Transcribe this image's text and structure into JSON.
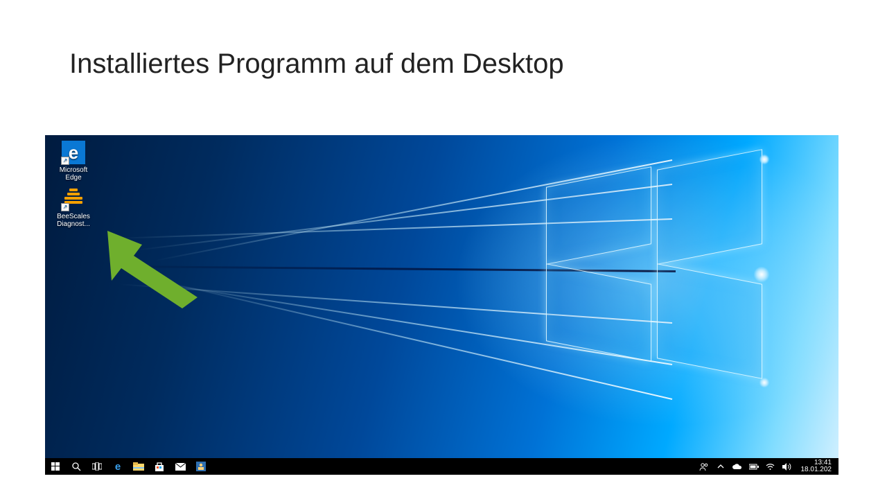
{
  "slide": {
    "title": "Installiertes Programm auf dem Desktop"
  },
  "desktop_icons": [
    {
      "label": "Microsoft Edge"
    },
    {
      "label": "BeeScales Diagnost..."
    }
  ],
  "taskbar": {
    "clock": {
      "time": "13:41",
      "date": "18.01.202"
    },
    "left_icons": [
      "start",
      "search",
      "taskview",
      "edge",
      "explorer",
      "store",
      "mail",
      "app"
    ],
    "tray_icons": [
      "people",
      "tray-up",
      "onedrive",
      "power",
      "wifi",
      "volume"
    ]
  },
  "annotation": {
    "arrow_color": "#6faf2d"
  }
}
